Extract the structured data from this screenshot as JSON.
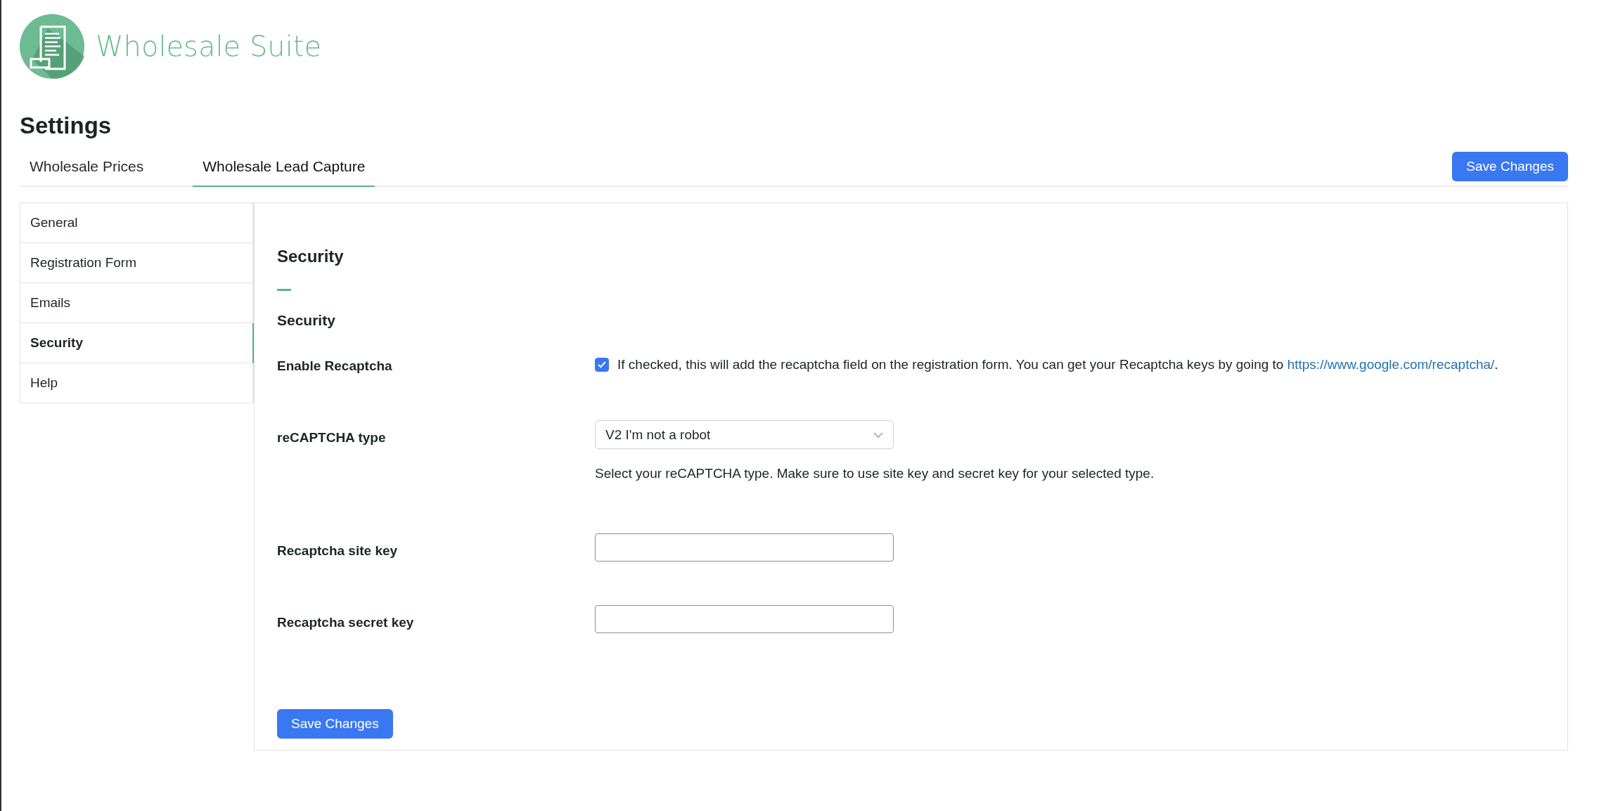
{
  "logo": {
    "text": "Wholesale Suite"
  },
  "page_title": "Settings",
  "tabs": [
    {
      "label": "Wholesale Prices",
      "selected": false
    },
    {
      "label": "Wholesale Lead Capture",
      "selected": true
    }
  ],
  "save_button": "Save Changes",
  "sidebar": {
    "items": [
      {
        "label": "General",
        "selected": false
      },
      {
        "label": "Registration Form",
        "selected": false
      },
      {
        "label": "Emails",
        "selected": false
      },
      {
        "label": "Security",
        "selected": true
      },
      {
        "label": "Help",
        "selected": false
      }
    ]
  },
  "content": {
    "title": "Security",
    "section_title": "Security",
    "fields": [
      {
        "kind": "checkbox",
        "label": "Enable Recaptcha",
        "checked": true,
        "description": "If checked, this will add the recaptcha field on the registration form. You can get your Recaptcha keys by going to",
        "link": "https://www.google.com/recaptcha/",
        "after": "."
      },
      {
        "kind": "select",
        "label": "reCAPTCHA type",
        "value": "V2 I'm not a robot",
        "description": "Select your reCAPTCHA type. Make sure to use site key and secret key for your selected type."
      },
      {
        "kind": "text",
        "label": "Recaptcha site key"
      },
      {
        "kind": "text",
        "label": "Recaptcha secret key"
      }
    ],
    "save_button": "Save Changes"
  }
}
